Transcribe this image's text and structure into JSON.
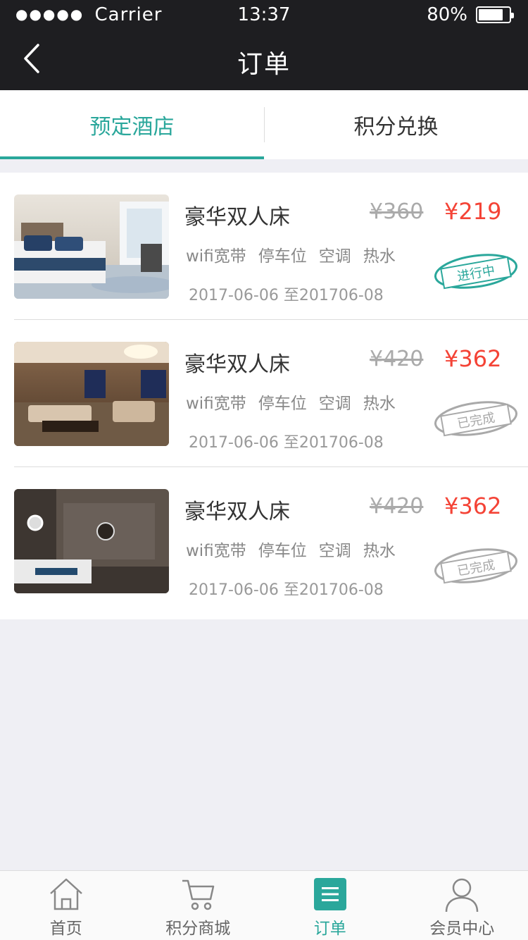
{
  "status_bar": {
    "signal_dots": "●●●●●",
    "carrier": "Carrier",
    "time": "13:37",
    "battery": "80%",
    "battery_level": 0.8
  },
  "nav": {
    "title": "订单"
  },
  "tabs": [
    {
      "label": "预定酒店",
      "active": true
    },
    {
      "label": "积分兑换",
      "active": false
    }
  ],
  "orders": [
    {
      "title": "豪华双人床",
      "price_old": "¥360",
      "price_new": "¥219",
      "amenities": [
        "wifi宽带",
        "停车位",
        "空调",
        "热水"
      ],
      "dates": "2017-06-06 至201706-08",
      "status": "进行中"
    },
    {
      "title": "豪华双人床",
      "price_old": "¥420",
      "price_new": "¥362",
      "amenities": [
        "wifi宽带",
        "停车位",
        "空调",
        "热水"
      ],
      "dates": "2017-06-06 至201706-08",
      "status": "已完成"
    },
    {
      "title": "豪华双人床",
      "price_old": "¥420",
      "price_new": "¥362",
      "amenities": [
        "wifi宽带",
        "停车位",
        "空调",
        "热水"
      ],
      "dates": "2017-06-06 至201706-08",
      "status": "已完成"
    }
  ],
  "tabbar": [
    {
      "label": "首页",
      "icon": "home-icon"
    },
    {
      "label": "积分商城",
      "icon": "cart-icon"
    },
    {
      "label": "订单",
      "icon": "list-icon",
      "active": true
    },
    {
      "label": "会员中心",
      "icon": "user-icon"
    }
  ],
  "colors": {
    "accent": "#2aa79b",
    "price": "#f44336",
    "topbar": "#1e1e21"
  }
}
